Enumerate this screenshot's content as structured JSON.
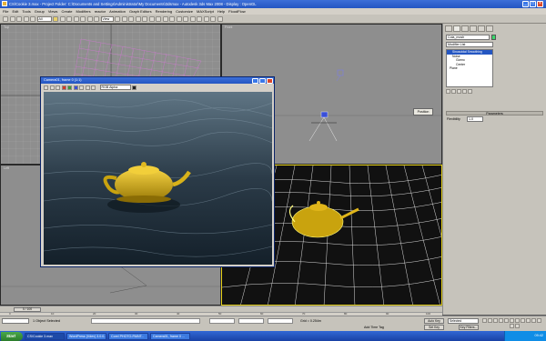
{
  "window": {
    "title": "CS\\Cookie 3.max - Project Folder: C:\\Documents and Settings\\Administrator\\My Documents\\3dsmax - Autodesk 3ds Max 2008 - Display : OpenGL",
    "min": "_",
    "max": "□",
    "close": "×"
  },
  "menu": [
    "File",
    "Edit",
    "Tools",
    "Group",
    "Views",
    "Create",
    "Modifiers",
    "reactor",
    "Animation",
    "Graph Editors",
    "Rendering",
    "Customize",
    "MAXScript",
    "Help",
    "FloodFlow"
  ],
  "toolbar": {
    "selection_filter": "All",
    "coord_system": "View"
  },
  "viewports": {
    "top_left": "Top",
    "top_right": "Front",
    "bottom_left": "Left",
    "bottom_right": "Perspective",
    "position_button": "Position"
  },
  "command_panel": {
    "object_name": "Cola_mosh",
    "modifier_list": "Modifier List",
    "stack": [
      {
        "label": "Sinusoidal Smoothing"
      },
      {
        "label": "Noise"
      },
      {
        "label": "Gizmo"
      },
      {
        "label": "Center"
      },
      {
        "label": "Plane"
      }
    ],
    "parameters_title": "Parameters",
    "flexibility_label": "Flexibility",
    "flexibility_value": "1.0"
  },
  "frame_window": {
    "title": "Camera01, frame 0 (1:1)",
    "channel": "RGB Alpha"
  },
  "timeline": {
    "slider": "0 / 100"
  },
  "ruler": [
    "0",
    "10",
    "20",
    "30",
    "40",
    "50",
    "60",
    "70",
    "80",
    "90",
    "100"
  ],
  "status": {
    "selection": "1 Object Selected",
    "grid": "Grid = 0.254m",
    "auto_key": "Auto Key",
    "set_key": "Set Key",
    "selected": "Selected",
    "key_filters": "Key Filters...",
    "add_time_tag": "Add Time Tag"
  },
  "taskbar": {
    "start": "Start",
    "tasks": [
      {
        "label": "CS\\Cookie 3.max"
      },
      {
        "label": "WordPress (Vdev) 3.0.0..."
      },
      {
        "label": "Corel PHOTO-PAINT..."
      },
      {
        "label": "Camera01, frame 0 ..."
      }
    ],
    "clock": "09:42"
  },
  "colors": {
    "accent": "#2456c2",
    "panel": "#c6c3bb",
    "teapot": "#e1b61a"
  }
}
